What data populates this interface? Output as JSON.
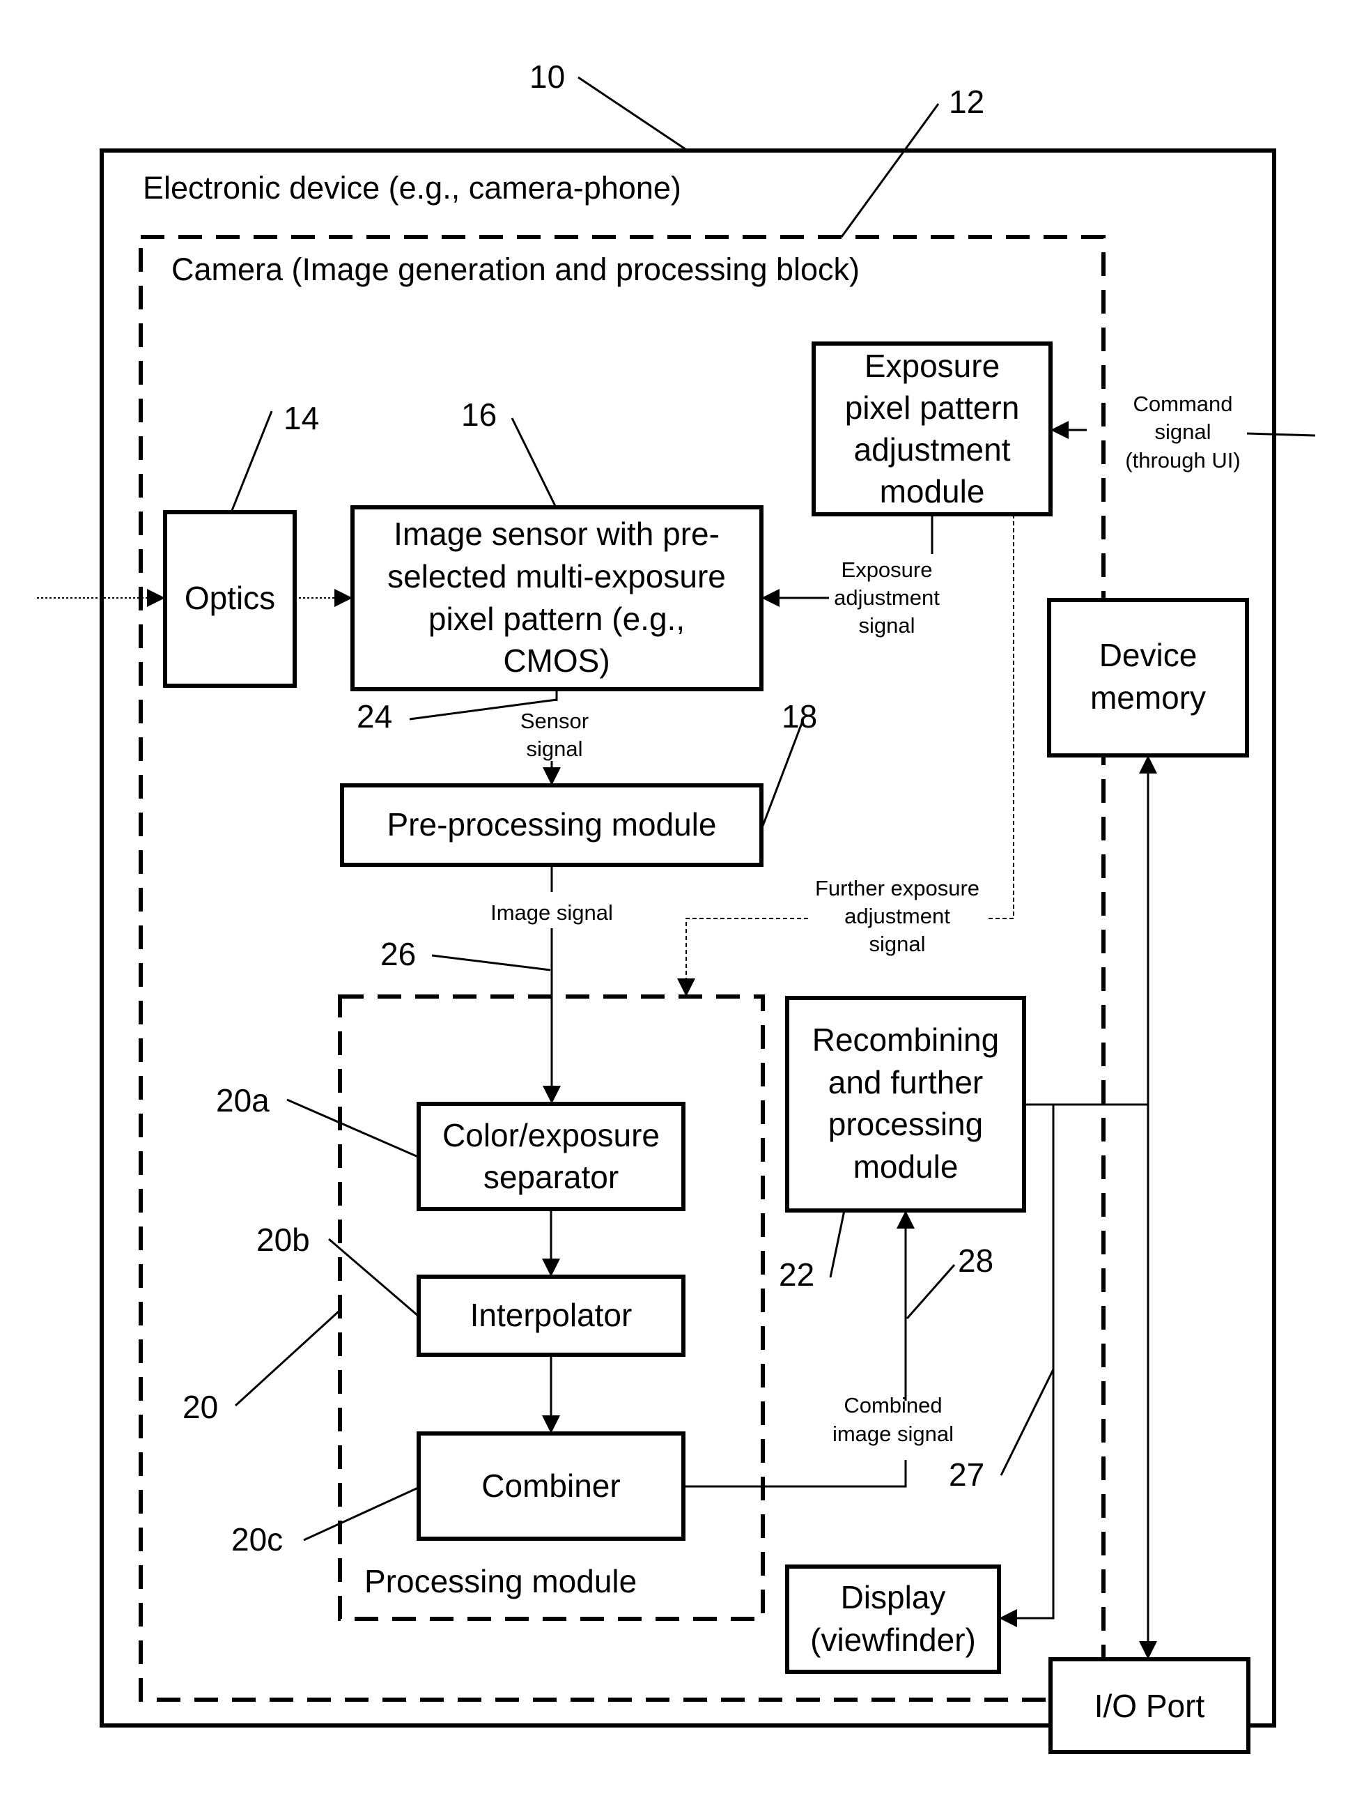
{
  "figure": {
    "containers": {
      "device": {
        "ref": "10",
        "title": "Electronic device (e.g., camera-phone)"
      },
      "camera": {
        "ref": "12",
        "title": "Camera (Image generation and processing block)"
      },
      "processing_module": {
        "ref": "20",
        "title": "Processing module"
      }
    },
    "blocks": {
      "optics": {
        "ref": "14",
        "lines": [
          "Optics"
        ]
      },
      "image_sensor": {
        "ref": "16",
        "lines": [
          "Image sensor with pre-",
          "selected multi-exposure",
          "pixel pattern (e.g.,",
          "CMOS)"
        ]
      },
      "exposure_module": {
        "lines": [
          "Exposure",
          "pixel pattern",
          "adjustment",
          "module"
        ]
      },
      "device_memory": {
        "lines": [
          "Device",
          "memory"
        ]
      },
      "preprocessing": {
        "ref": "18",
        "lines": [
          "Pre-processing module"
        ]
      },
      "separator": {
        "ref": "20a",
        "lines": [
          "Color/exposure",
          "separator"
        ]
      },
      "interpolator": {
        "ref": "20b",
        "lines": [
          "Interpolator"
        ]
      },
      "combiner": {
        "ref": "20c",
        "lines": [
          "Combiner"
        ]
      },
      "recombining": {
        "ref": "22",
        "lines": [
          "Recombining",
          "and further",
          "processing",
          "module"
        ]
      },
      "display": {
        "lines": [
          "Display",
          "(viewfinder)"
        ]
      },
      "io_port": {
        "lines": [
          "I/O Port"
        ]
      }
    },
    "signals": {
      "command": {
        "lines": [
          "Command",
          "signal",
          "(through UI)"
        ]
      },
      "exposure_adjustment": {
        "lines": [
          "Exposure",
          "adjustment",
          "signal"
        ]
      },
      "sensor": {
        "ref": "24",
        "lines": [
          "Sensor",
          "signal"
        ]
      },
      "image": {
        "ref": "26",
        "lines": [
          "Image signal"
        ]
      },
      "further_exposure": {
        "lines": [
          "Further exposure",
          "adjustment",
          "signal"
        ]
      },
      "combined_image": {
        "ref": "28",
        "lines": [
          "Combined",
          "image signal"
        ]
      },
      "output_bus": {
        "ref": "27"
      }
    }
  }
}
